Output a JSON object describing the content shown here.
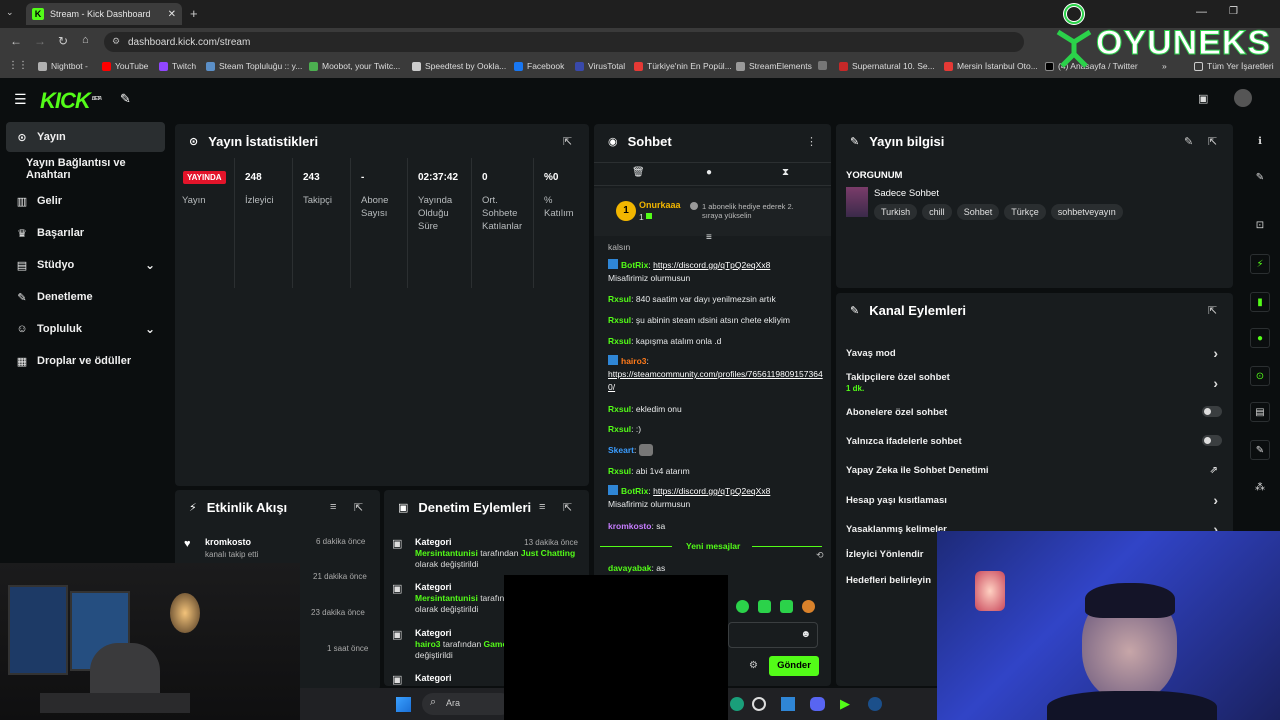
{
  "browser": {
    "tab_title": "Stream - Kick Dashboard",
    "url": "dashboard.kick.com/stream"
  },
  "bookmarks": [
    {
      "label": "Nightbot -",
      "color": "#b0b0b0"
    },
    {
      "label": "YouTube",
      "color": "#ff0000"
    },
    {
      "label": "Twitch",
      "color": "#9146ff"
    },
    {
      "label": "Steam Topluluğu :: y...",
      "color": "#1b2838"
    },
    {
      "label": "Moobot, your Twitc...",
      "color": "#4caf50"
    },
    {
      "label": "Speedtest by Ookla...",
      "color": "#222"
    },
    {
      "label": "Facebook",
      "color": "#1877f2"
    },
    {
      "label": "VirusTotal",
      "color": "#3949ab"
    },
    {
      "label": "Türkiye'nin En Popül...",
      "color": "#e53935"
    },
    {
      "label": "StreamElements",
      "color": "#555"
    },
    {
      "label": "",
      "color": "#777"
    },
    {
      "label": "Supernatural 10. Se...",
      "color": "#c62828"
    },
    {
      "label": "Mersin İstanbul Oto...",
      "color": "#e53935"
    },
    {
      "label": "(4) Anasayfa / Twitter",
      "color": "#000"
    }
  ],
  "bookmarks_more": "»",
  "all_bookmarks": "Tüm Yer İşaretleri",
  "brand": "KICK",
  "brand_beta": "BETA",
  "watermark": "OYUNEKS",
  "sidebar": {
    "items": [
      {
        "label": "Yayın",
        "icon": "broadcast-icon"
      },
      {
        "label": "Yayın Bağlantısı ve Anahtarı",
        "icon": ""
      },
      {
        "label": "Gelir",
        "icon": "chart-icon"
      },
      {
        "label": "Başarılar",
        "icon": "trophy-icon"
      },
      {
        "label": "Stüdyo",
        "icon": "studio-icon"
      },
      {
        "label": "Denetleme",
        "icon": "wrench-icon"
      },
      {
        "label": "Topluluk",
        "icon": "people-icon"
      },
      {
        "label": "Droplar ve ödüller",
        "icon": "gift-icon"
      }
    ]
  },
  "stats": {
    "title": "Yayın İstatistikleri",
    "live": "YAYINDA",
    "live_label": "Yayın",
    "cells": [
      {
        "value": "248",
        "label": "İzleyici"
      },
      {
        "value": "243",
        "label": "Takipçi"
      },
      {
        "value": "-",
        "label": "Abone Sayısı"
      },
      {
        "value": "02:37:42",
        "label": "Yayında Olduğu Süre"
      },
      {
        "value": "0",
        "label": "Ort. Sohbete Katılanlar"
      },
      {
        "value": "%0",
        "label": "% Katılım"
      }
    ]
  },
  "chat": {
    "title": "Sohbet",
    "gift_user": "Onurkaaa",
    "gift_count": "1",
    "gift_text": "1 abonelik hediye ederek 2. sıraya yükselin",
    "truncated": "kalsın",
    "messages": [
      {
        "user": "BotRix",
        "color": "#53fc18",
        "bot": true,
        "text": "",
        "link": "https://discord.gg/qTpQ2eqXx8",
        "after": "Misafirimiz olurmusun"
      },
      {
        "user": "Rxsul",
        "color": "#53fc18",
        "text": "840 saatim var dayı yenilmezsin artık"
      },
      {
        "user": "Rxsul",
        "color": "#53fc18",
        "text": "şu abinin steam ıdsini atsın chete ekliyim"
      },
      {
        "user": "Rxsul",
        "color": "#53fc18",
        "text": "kapışma atalım onla .d"
      },
      {
        "user": "hairo3",
        "color": "#ff7a1a",
        "bot": true,
        "text": "",
        "link": "https://steamcommunity.com/profiles/76561198091573640/"
      },
      {
        "user": "Rxsul",
        "color": "#53fc18",
        "text": "ekledim onu"
      },
      {
        "user": "Rxsul",
        "color": "#53fc18",
        "text": ":)"
      },
      {
        "user": "Skeart",
        "color": "#3b9dff",
        "text": ""
      },
      {
        "user": "Rxsul",
        "color": "#53fc18",
        "text": "abi 1v4 atarım"
      },
      {
        "user": "BotRix",
        "color": "#53fc18",
        "bot": true,
        "text": "",
        "link": "https://discord.gg/qTpQ2eqXx8",
        "after": "Misafirimiz olurmusun"
      },
      {
        "user": "kromkosto",
        "color": "#c77dff",
        "text": "sa"
      }
    ],
    "new_messages": "Yeni mesajlar",
    "last_user": "davayabak",
    "last_text": "as",
    "send": "Gönder"
  },
  "info": {
    "title": "Yayın bilgisi",
    "stream_title": "YORGUNUM",
    "category": "Sadece Sohbet",
    "tags": [
      "Turkish",
      "chill",
      "Sohbet",
      "Türkçe",
      "sohbetveyayın"
    ]
  },
  "actions": {
    "title": "Kanal Eylemleri",
    "items": [
      {
        "label": "Yavaş mod",
        "type": "chevron"
      },
      {
        "label": "Takipçilere özel sohbet",
        "sub": "1 dk.",
        "type": "chevron"
      },
      {
        "label": "Abonelere özel sohbet",
        "type": "toggle"
      },
      {
        "label": "Yalnızca ifadelerle sohbet",
        "type": "toggle"
      },
      {
        "label": "Yapay Zeka ile Sohbet Denetimi",
        "type": "external"
      },
      {
        "label": "Hesap yaşı kısıtlaması",
        "type": "chevron"
      },
      {
        "label": "Yasaklanmış kelimeler",
        "type": "chevron"
      },
      {
        "label": "İzleyici Yönlendir",
        "type": "none"
      },
      {
        "label": "Hedefleri belirleyin",
        "type": "none"
      }
    ]
  },
  "events": {
    "title": "Etkinlik Akışı",
    "first_user": "kromkosto",
    "first_text": "kanalı takip etti",
    "times": [
      "6 dakika önce",
      "21 dakika önce",
      "23 dakika önce",
      "1 saat önce"
    ]
  },
  "moderation": {
    "title": "Denetim Eylemleri",
    "items": [
      {
        "title": "Kategori",
        "time": "13 dakika önce",
        "user": "Mersintantunisi",
        "mid": "tarafından",
        "cat": "Just Chatting",
        "end": "olarak değiştirildi"
      },
      {
        "title": "Kategori",
        "time": "",
        "user": "Mersintantunisi",
        "mid": "tarafından",
        "cat": "",
        "end": "olarak değiştirildi"
      },
      {
        "title": "Kategori",
        "time": "",
        "user": "hairo3",
        "mid": "tarafından",
        "cat": "Game",
        "end": "değiştirildi"
      },
      {
        "title": "Kategori",
        "time": "",
        "user": "",
        "mid": "",
        "cat": "",
        "end": ""
      }
    ]
  },
  "taskbar": {
    "search": "Ara"
  }
}
